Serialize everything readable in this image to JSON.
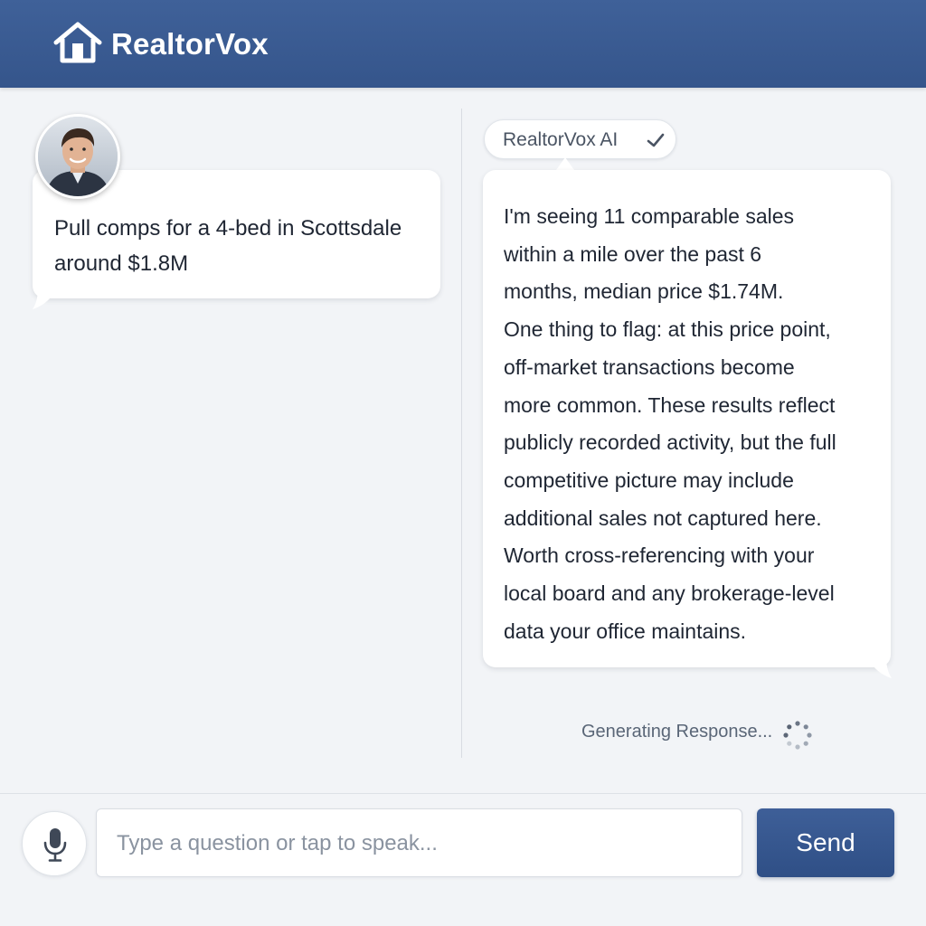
{
  "app": {
    "title": "RealtorVox",
    "logo_icon": "house-icon"
  },
  "conversation": {
    "user_message": {
      "avatar": "user-avatar",
      "text": "Pull comps for a 4-bed in Scottsdale around $1.8M"
    },
    "ai_message": {
      "sender_label": "RealtorVox AI",
      "verified_icon": "checkmark-icon",
      "lines": [
        "I'm seeing 11 comparable sales",
        "within a mile over the past 6",
        "months, median price $1.74M.",
        "One thing to flag: at this price point,",
        "off-market transactions become",
        "more common. These results reflect",
        "publicly recorded activity, but the full",
        "competitive picture may include",
        "additional sales not captured here.",
        "Worth cross-referencing with your",
        "local board and any brokerage-level",
        "data your office maintains."
      ]
    },
    "status": {
      "text": "Generating Response...",
      "icon": "loading-spinner-icon"
    }
  },
  "composer": {
    "mic_icon": "microphone-icon",
    "input_placeholder": "Type a question or tap to speak...",
    "input_value": "",
    "send_label": "Send"
  },
  "colors": {
    "header": "#3f6199",
    "send_button": "#34548b",
    "background": "#f2f4f7"
  }
}
